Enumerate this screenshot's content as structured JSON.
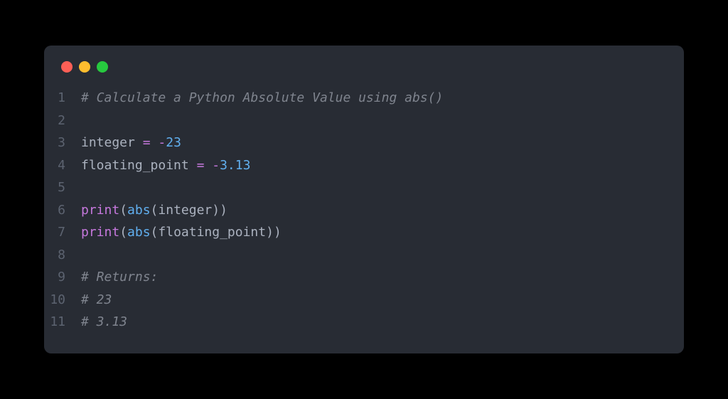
{
  "code": {
    "lines": [
      {
        "num": "1",
        "tokens": [
          {
            "cls": "comment",
            "text": "# Calculate a Python Absolute Value using abs()"
          }
        ]
      },
      {
        "num": "2",
        "tokens": []
      },
      {
        "num": "3",
        "tokens": [
          {
            "cls": "identifier",
            "text": "integer"
          },
          {
            "cls": "identifier",
            "text": " "
          },
          {
            "cls": "operator",
            "text": "="
          },
          {
            "cls": "identifier",
            "text": " "
          },
          {
            "cls": "number-minus",
            "text": "-"
          },
          {
            "cls": "number",
            "text": "23"
          }
        ]
      },
      {
        "num": "4",
        "tokens": [
          {
            "cls": "identifier",
            "text": "floating_point"
          },
          {
            "cls": "identifier",
            "text": " "
          },
          {
            "cls": "operator",
            "text": "="
          },
          {
            "cls": "identifier",
            "text": " "
          },
          {
            "cls": "number-minus",
            "text": "-"
          },
          {
            "cls": "number",
            "text": "3.13"
          }
        ]
      },
      {
        "num": "5",
        "tokens": []
      },
      {
        "num": "6",
        "tokens": [
          {
            "cls": "builtin",
            "text": "print"
          },
          {
            "cls": "paren",
            "text": "("
          },
          {
            "cls": "function",
            "text": "abs"
          },
          {
            "cls": "paren",
            "text": "("
          },
          {
            "cls": "identifier",
            "text": "integer"
          },
          {
            "cls": "paren",
            "text": "))"
          }
        ]
      },
      {
        "num": "7",
        "tokens": [
          {
            "cls": "builtin",
            "text": "print"
          },
          {
            "cls": "paren",
            "text": "("
          },
          {
            "cls": "function",
            "text": "abs"
          },
          {
            "cls": "paren",
            "text": "("
          },
          {
            "cls": "identifier",
            "text": "floating_point"
          },
          {
            "cls": "paren",
            "text": "))"
          }
        ]
      },
      {
        "num": "8",
        "tokens": []
      },
      {
        "num": "9",
        "tokens": [
          {
            "cls": "comment",
            "text": "# Returns:"
          }
        ]
      },
      {
        "num": "10",
        "tokens": [
          {
            "cls": "comment",
            "text": "# 23"
          }
        ]
      },
      {
        "num": "11",
        "tokens": [
          {
            "cls": "comment",
            "text": "# 3.13"
          }
        ]
      }
    ]
  }
}
